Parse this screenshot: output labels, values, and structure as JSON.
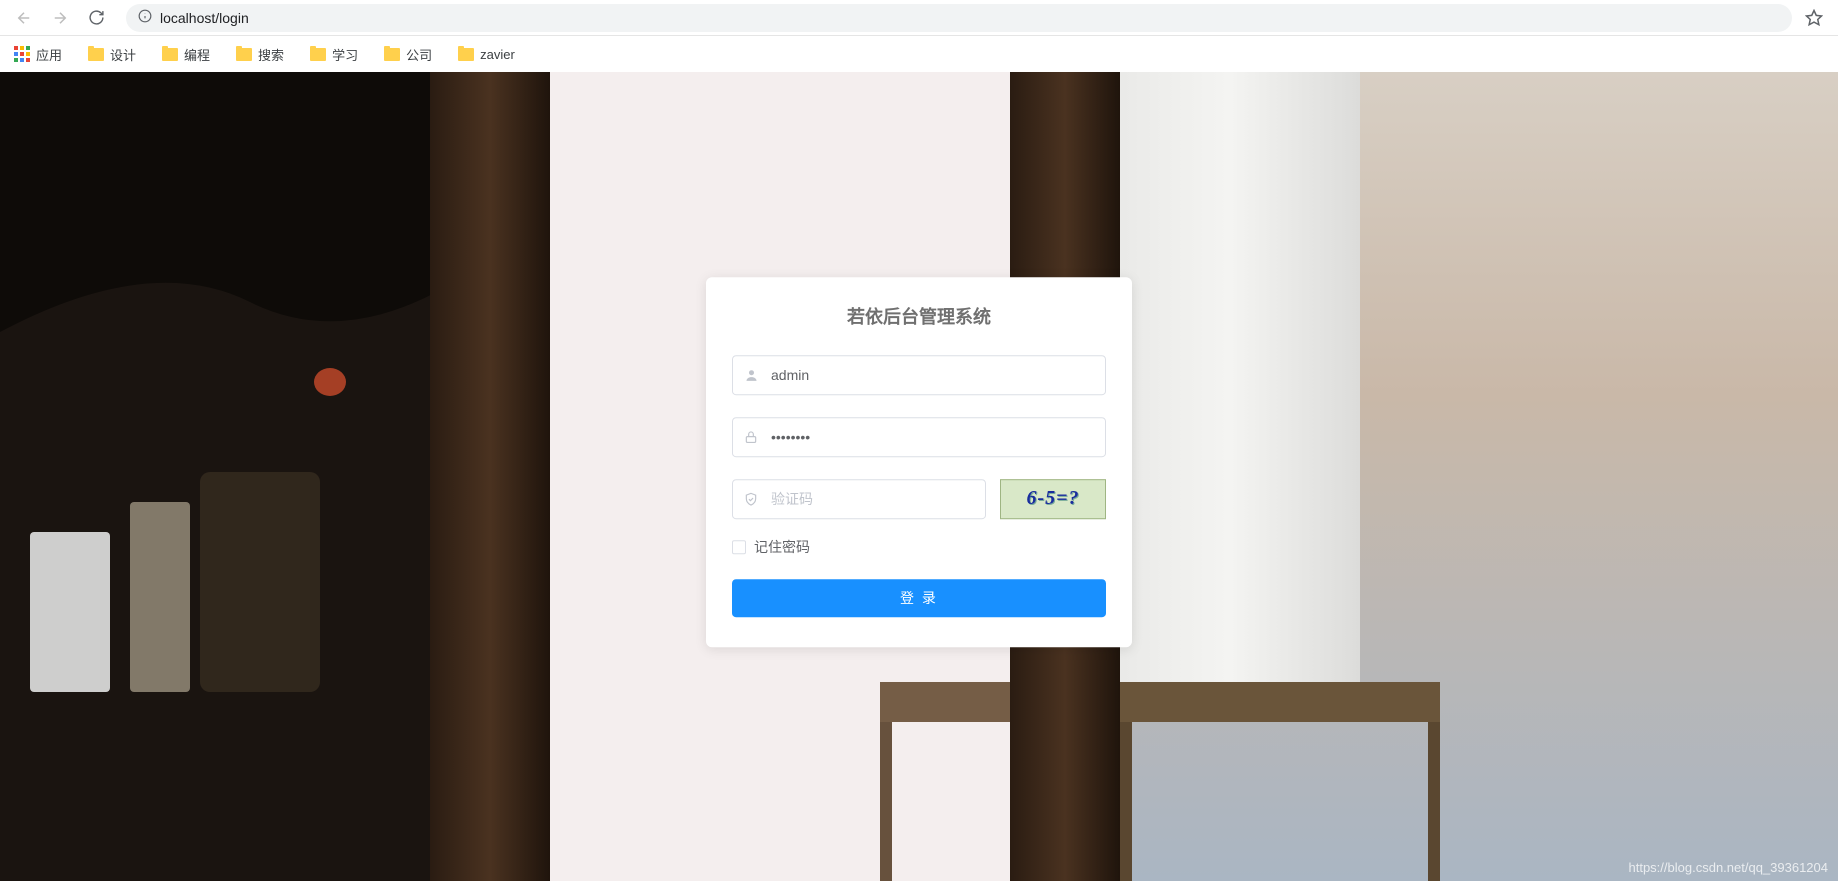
{
  "browser": {
    "url": "localhost/login"
  },
  "bookmarks": {
    "apps_label": "应用",
    "items": [
      {
        "label": "设计"
      },
      {
        "label": "编程"
      },
      {
        "label": "搜索"
      },
      {
        "label": "学习"
      },
      {
        "label": "公司"
      },
      {
        "label": "zavier"
      }
    ]
  },
  "login": {
    "title": "若依后台管理系统",
    "username_value": "admin",
    "password_value": "••••••••",
    "captcha_placeholder": "验证码",
    "captcha_text": "6-5=?",
    "remember_label": "记住密码",
    "submit_label": "登 录"
  },
  "watermark": "https://blog.csdn.net/qq_39361204"
}
